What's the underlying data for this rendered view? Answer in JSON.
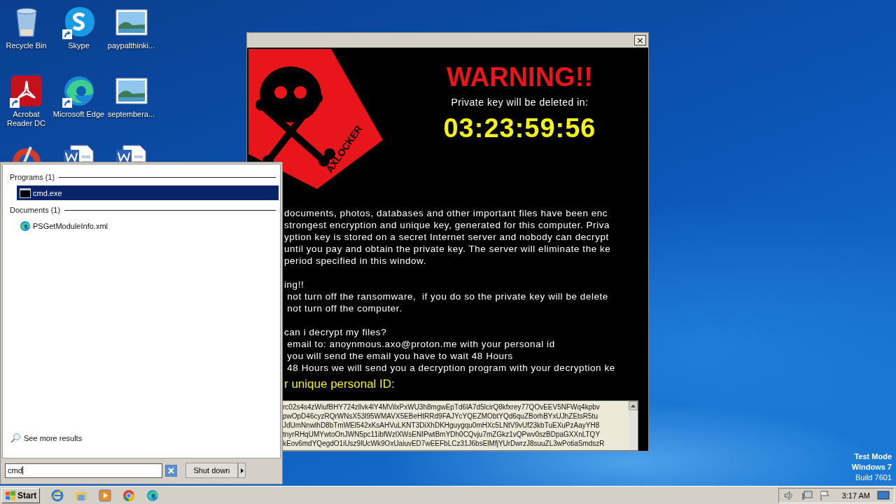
{
  "desktop_icons": [
    {
      "kind": "recyclebin",
      "label": "Recycle Bin",
      "shortcut": false
    },
    {
      "kind": "skype",
      "label": "Skype",
      "shortcut": true
    },
    {
      "kind": "image",
      "label": "paypalthinki...",
      "shortcut": false
    },
    {
      "kind": "pdf",
      "label": "Acrobat Reader DC",
      "shortcut": true
    },
    {
      "kind": "edge",
      "label": "Microsoft Edge",
      "shortcut": true
    },
    {
      "kind": "image",
      "label": "septembera...",
      "shortcut": false
    },
    {
      "kind": "ccleaner"
    },
    {
      "kind": "word"
    },
    {
      "kind": "word"
    }
  ],
  "ransom_window": {
    "close": "×",
    "brand": "AXLOCKER",
    "warning": "WARNING!!",
    "countdown_label": "Private key will be deleted in:",
    "countdown": "03:23:59:56",
    "blocks": [
      {
        "lines": [
          "documents, photos, databases and other important files have been enc",
          "strongest encryption and unique key, generated for this computer. Priva",
          "yption key is stored on a secret Internet server and nobody can decrypt",
          "until you pay and obtain the private key. The server will eliminate the ke",
          "period specified in this window."
        ]
      },
      {
        "lines": [
          "ing!!",
          " not turn off the ransomware,  if you do so the private key will be delete",
          " not turn off the computer."
        ]
      },
      {
        "lines": [
          "can i decrypt my files?",
          " email to: anoynmous.axo@proton.me with your personal id",
          " you will send the email you have to wait 48 Hours",
          " 48 Hours we will send you a decryption program with your decryption ke"
        ]
      }
    ],
    "id_heading": "r unique personal ID:",
    "id_lines": [
      "rc02s4s4zWiufBHY724zllvk4lY4MVilxPxWU3h8mgwEpTd6lA7d5lcirQ8kfxrey77QOvEEV5NFWq4kpbv",
      "pwOpD46cyzRQrWNsX53l95WMAVX5EBeHtRRd9FAJYcYQEZMObtYQd6quZBorhBYxUJhZEtsR5tu",
      "JdUmNnwlhD8bTmWEl542xKsAHVuLKNT3DiXhDKHguygqu0mHXc5LNtV9vUf23kbTuEXuPzAayYH8",
      "tnyrRHqUMYwtoOnJWN5pc11ibfWzlXWsENIPwtBmYDh0CQvju7mZGkz1vQPwv0szBDpaGXXnLTQY",
      "kEov6mdYQegdO1iUsz9lUcWk9OxUaiuvED7wEEFbLCz31J6bsElMfjYUrDwrzJ8suuZL3wPotiaSmdszR"
    ]
  },
  "start_menu": {
    "groups": [
      {
        "header": "Programs (1)",
        "items": [
          {
            "kind": "cmd",
            "label": "cmd.exe",
            "selected": true
          }
        ]
      },
      {
        "header": "Documents (1)",
        "items": [
          {
            "kind": "edge",
            "label": "PSGetModuleInfo.xml",
            "selected": false
          }
        ]
      }
    ],
    "see_more": "See more results",
    "search": {
      "value": "cmd"
    },
    "shutdown": "Shut down"
  },
  "os_watermark": {
    "mode": "Test Mode",
    "edition": "Windows 7",
    "build": "Build 7601"
  },
  "taskbar": {
    "start": "Start",
    "apps": [
      {
        "kind": "ie"
      },
      {
        "kind": "explorer"
      },
      {
        "kind": "media"
      },
      {
        "kind": "chrome"
      },
      {
        "kind": "edge"
      }
    ],
    "clock": "3:17 AM"
  }
}
